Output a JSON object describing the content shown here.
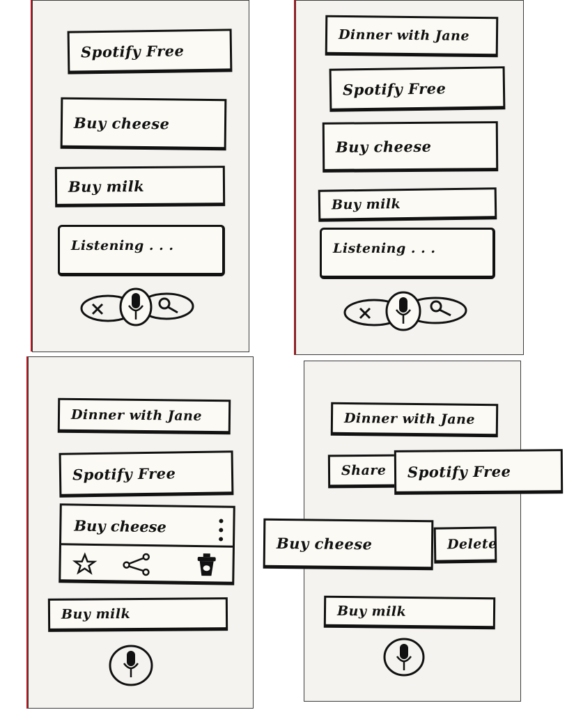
{
  "colors": {
    "paper": "#f4f3ef",
    "card": "#fbfaf4",
    "ink": "#111111",
    "accent": "#b3141c"
  },
  "panel1": {
    "cards": [
      "Spotify Free",
      "Buy cheese",
      "Buy milk"
    ],
    "listening": "Listening . . .",
    "controls": [
      "close-icon",
      "microphone-icon",
      "search-icon"
    ]
  },
  "panel2": {
    "cards": [
      "Dinner with Jane",
      "Spotify Free",
      "Buy cheese",
      "Buy milk"
    ],
    "listening": "Listening . . .",
    "controls": [
      "close-icon",
      "microphone-icon",
      "search-icon"
    ]
  },
  "panel3": {
    "cards": [
      "Dinner with Jane",
      "Spotify Free",
      "Buy cheese",
      "Buy milk"
    ],
    "actions": [
      "more-vertical-icon",
      "star-icon",
      "share-icon",
      "trash-icon"
    ],
    "mic": "microphone-icon"
  },
  "panel4": {
    "cards": [
      "Dinner with Jane",
      "Spotify Free",
      "Buy cheese",
      "Buy milk"
    ],
    "share": "Share",
    "delete": "Delete",
    "mic": "microphone-icon"
  }
}
